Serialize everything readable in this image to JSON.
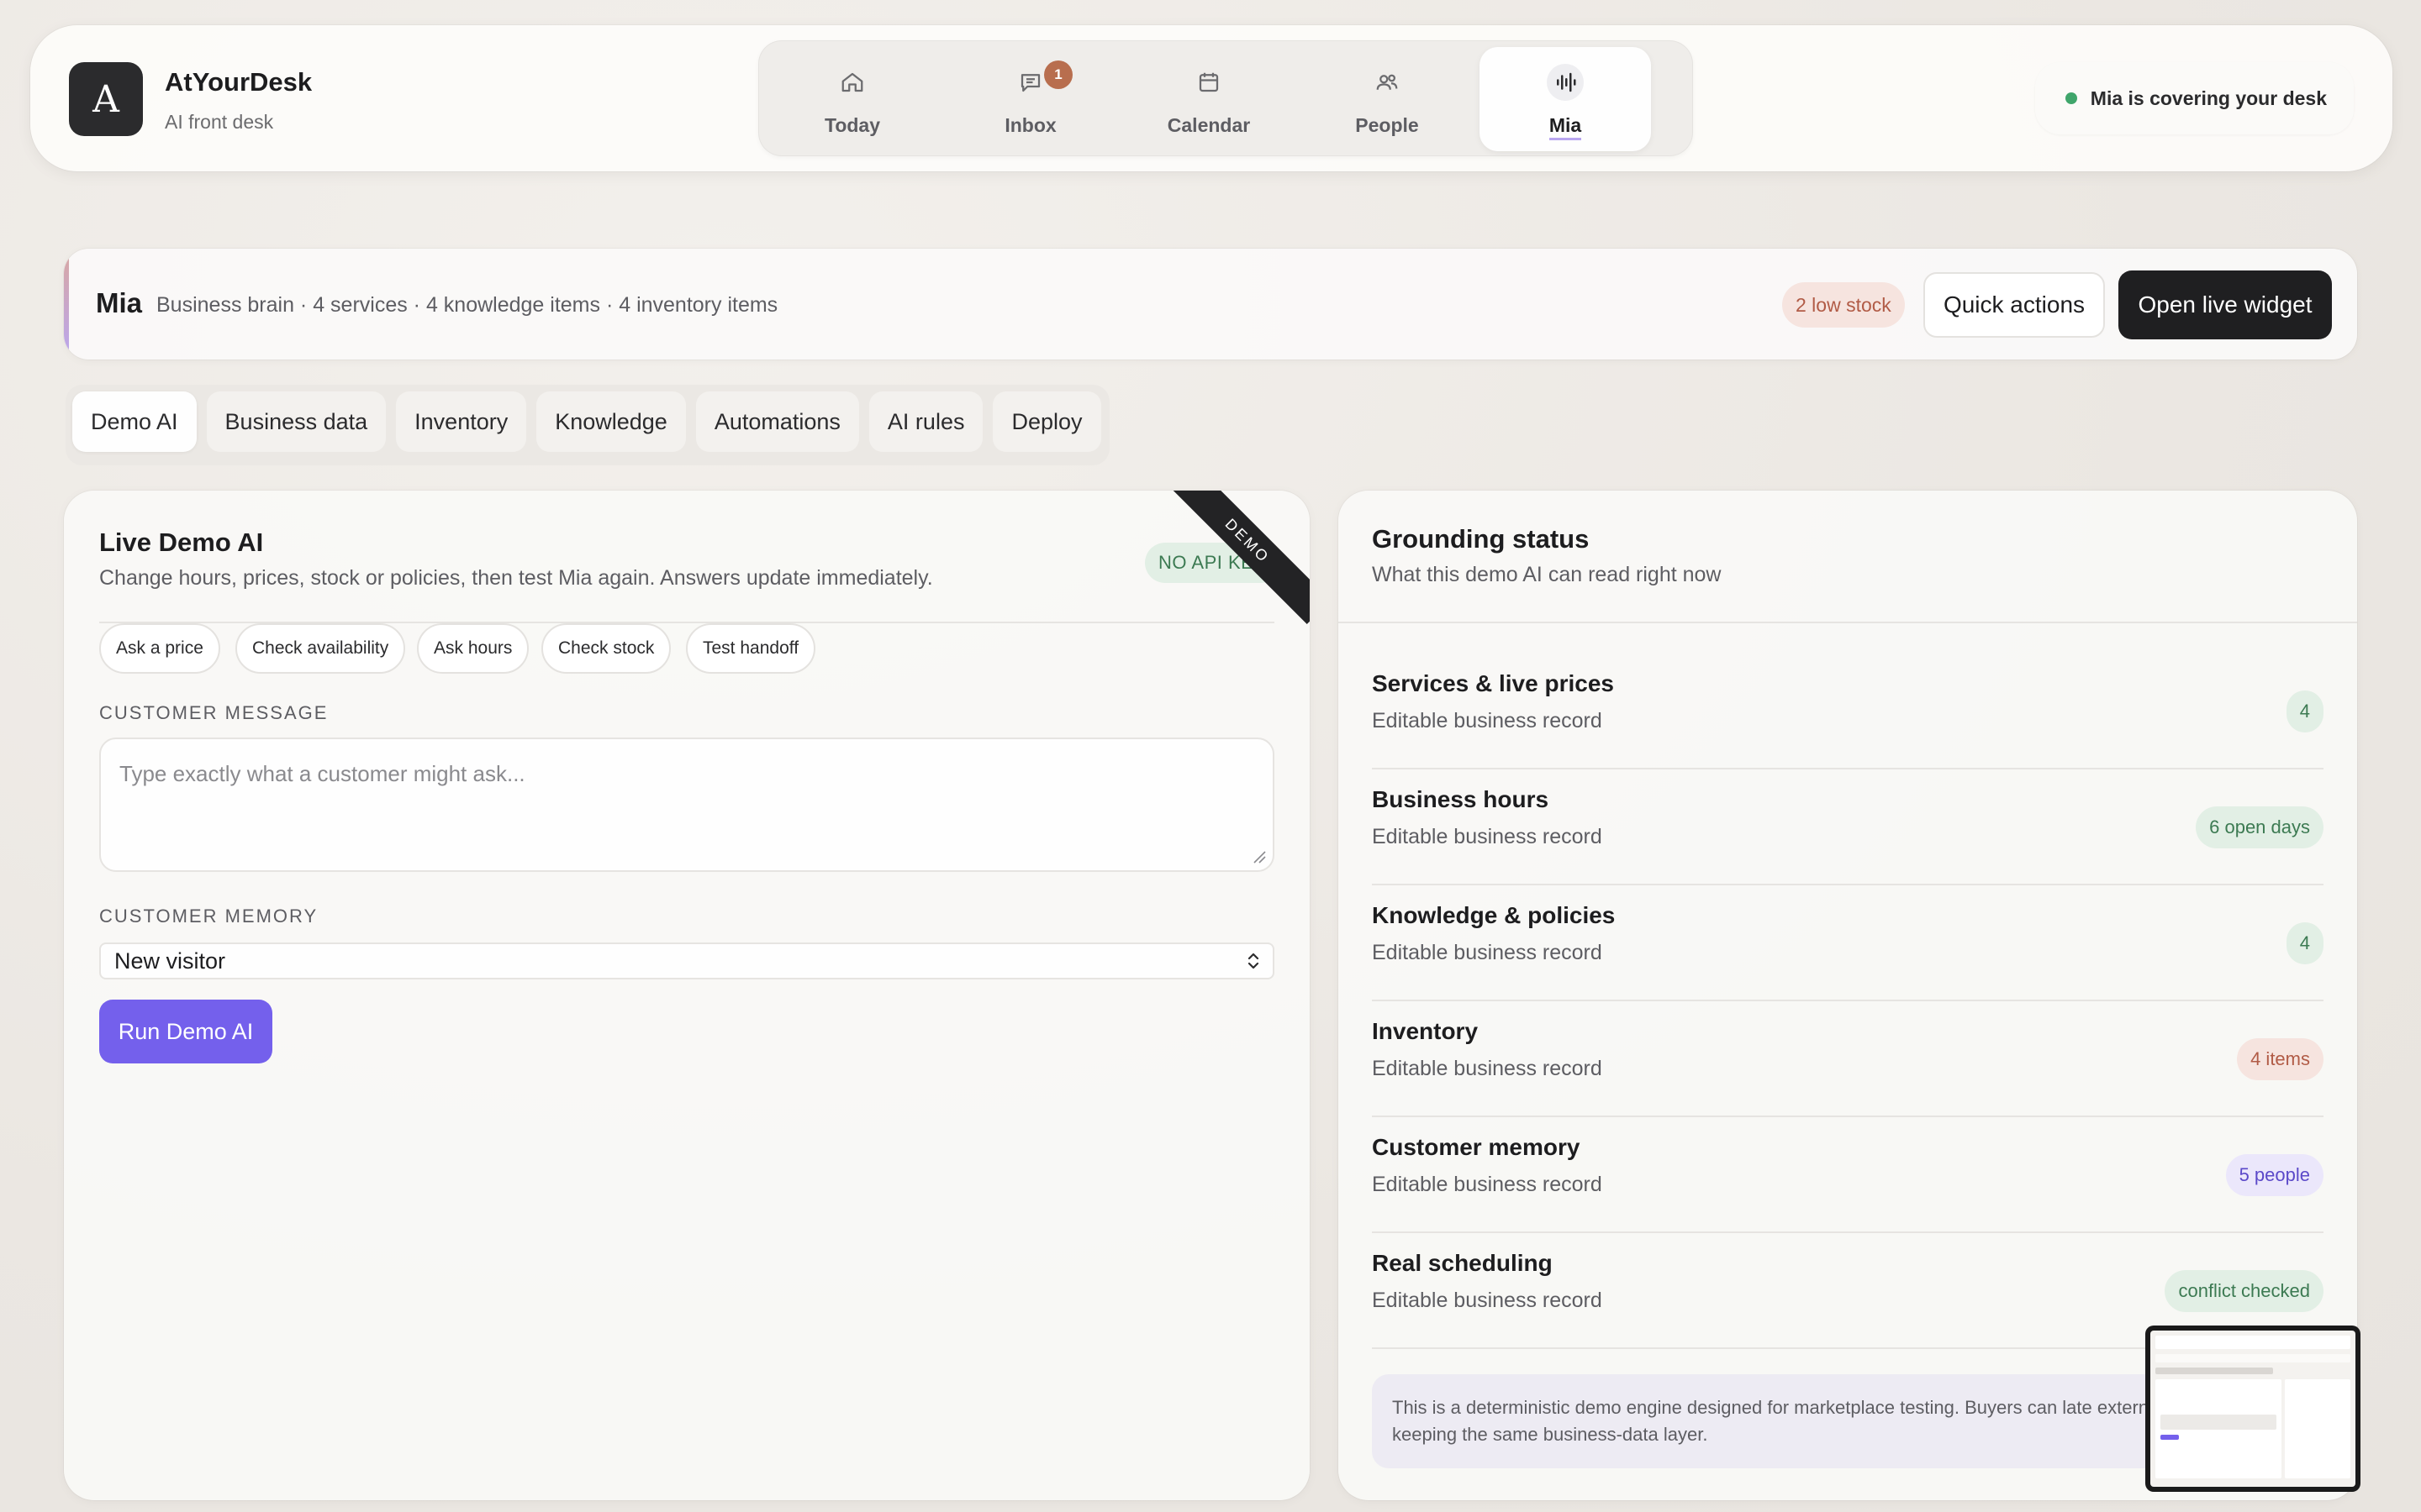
{
  "app": {
    "logo_letter": "A",
    "name": "AtYourDesk",
    "subtitle": "AI front desk"
  },
  "nav": {
    "items": [
      {
        "label": "Today",
        "icon": "home-icon"
      },
      {
        "label": "Inbox",
        "icon": "chat-icon",
        "badge": "1"
      },
      {
        "label": "Calendar",
        "icon": "calendar-icon"
      },
      {
        "label": "People",
        "icon": "people-icon"
      },
      {
        "label": "Mia",
        "icon": "waveform-icon",
        "active": true
      }
    ]
  },
  "status": {
    "text": "Mia is covering your desk",
    "color": "#3fa56b"
  },
  "mia_bar": {
    "title": "Mia",
    "description": "Business brain · 4 services · 4 knowledge items · 4 inventory items",
    "low_stock": "2 low stock",
    "quick_actions": "Quick actions",
    "open_widget": "Open live widget"
  },
  "tabs": [
    "Demo AI",
    "Business data",
    "Inventory",
    "Knowledge",
    "Automations",
    "AI rules",
    "Deploy"
  ],
  "demo": {
    "title": "Live Demo AI",
    "subtitle": "Change hours, prices, stock or policies, then test Mia again. Answers update immediately.",
    "api_badge": "NO API KEY",
    "ribbon": "DEMO",
    "chips": [
      "Ask a price",
      "Check availability",
      "Ask hours",
      "Check stock",
      "Test handoff"
    ],
    "message_label": "CUSTOMER MESSAGE",
    "message_placeholder": "Type exactly what a customer might ask...",
    "memory_label": "CUSTOMER MEMORY",
    "memory_value": "New visitor",
    "run_button": "Run Demo AI"
  },
  "grounding": {
    "title": "Grounding status",
    "subtitle": "What this demo AI can read right now",
    "rows": [
      {
        "title": "Services & live prices",
        "sub": "Editable business record",
        "badge": "4",
        "tone": "green"
      },
      {
        "title": "Business hours",
        "sub": "Editable business record",
        "badge": "6 open days",
        "tone": "green"
      },
      {
        "title": "Knowledge & policies",
        "sub": "Editable business record",
        "badge": "4",
        "tone": "green"
      },
      {
        "title": "Inventory",
        "sub": "Editable business record",
        "badge": "4 items",
        "tone": "red"
      },
      {
        "title": "Customer memory",
        "sub": "Editable business record",
        "badge": "5 people",
        "tone": "purple"
      },
      {
        "title": "Real scheduling",
        "sub": "Editable business record",
        "badge": "conflict checked",
        "tone": "green"
      }
    ],
    "note": "This is a deterministic demo engine designed for marketplace testing. Buyers can late external LLM while keeping the same business-data layer."
  },
  "colors": {
    "accent": "#7460ec",
    "dark": "#1f1f21",
    "inbox_badge": "#b86e4e"
  }
}
